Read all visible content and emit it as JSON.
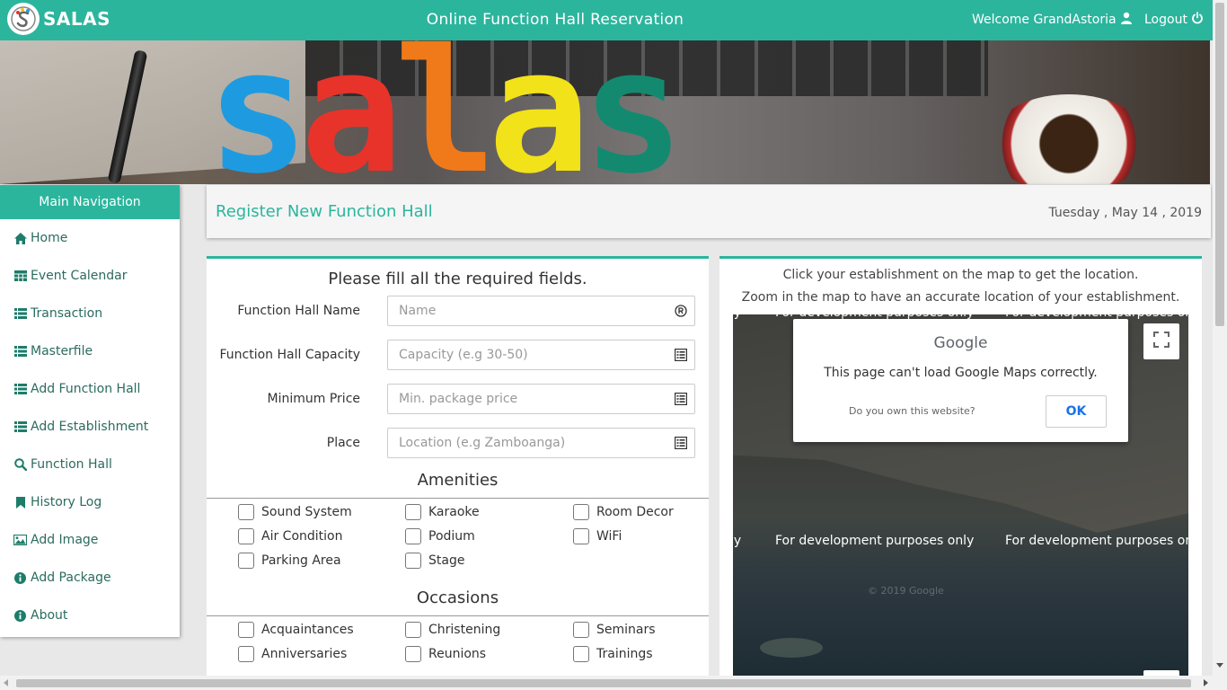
{
  "app": {
    "logo_text": "SALAS",
    "title": "Online Function Hall Reservation",
    "welcome": "Welcome GrandAstoria",
    "logout": "Logout",
    "accent_color": "#2bb59d"
  },
  "banner": {
    "letters": [
      {
        "char": "s",
        "color": "#1e9be0"
      },
      {
        "char": "a",
        "color": "#e8332a"
      },
      {
        "char": "l",
        "color": "#f07a1a"
      },
      {
        "char": "a",
        "color": "#f2e21a"
      },
      {
        "char": "s",
        "color": "#138a6f"
      }
    ]
  },
  "sidebar": {
    "heading": "Main Navigation",
    "items": [
      {
        "label": "Home",
        "icon": "home-icon"
      },
      {
        "label": "Event Calendar",
        "icon": "table-icon"
      },
      {
        "label": "Transaction",
        "icon": "list-icon"
      },
      {
        "label": "Masterfile",
        "icon": "list-icon"
      },
      {
        "label": "Add Function Hall",
        "icon": "list-icon"
      },
      {
        "label": "Add Establishment",
        "icon": "list-icon"
      },
      {
        "label": "Function Hall",
        "icon": "search-icon"
      },
      {
        "label": "History Log",
        "icon": "bookmark-icon"
      },
      {
        "label": "Add Image",
        "icon": "image-icon"
      },
      {
        "label": "Add Package",
        "icon": "info-icon"
      },
      {
        "label": "About",
        "icon": "info-icon"
      }
    ]
  },
  "header": {
    "title": "Register New Function Hall",
    "date": "Tuesday , May 14 , 2019"
  },
  "form": {
    "heading": "Please fill all the required fields.",
    "fields": [
      {
        "label": "Function Hall Name",
        "placeholder": "Name",
        "value": "",
        "icon": "registered-icon"
      },
      {
        "label": "Function Hall Capacity",
        "placeholder": "Capacity (e.g 30-50)",
        "value": "",
        "icon": "list-box-icon"
      },
      {
        "label": "Minimum Price",
        "placeholder": "Min. package price",
        "value": "",
        "icon": "list-box-icon"
      },
      {
        "label": "Place",
        "placeholder": "Location (e.g Zamboanga)",
        "value": "",
        "icon": "list-box-icon"
      }
    ],
    "amenities_title": "Amenities",
    "amenities": [
      [
        "Sound System",
        "Karaoke",
        "Room Decor"
      ],
      [
        "Air Condition",
        "Podium",
        "WiFi"
      ],
      [
        "Parking Area",
        "Stage",
        ""
      ]
    ],
    "occasions_title": "Occasions",
    "occasions": [
      [
        "Acquaintances",
        "Christening",
        "Seminars"
      ],
      [
        "Anniversaries",
        "Reunions",
        "Trainings"
      ]
    ]
  },
  "map": {
    "instruction_1": "Click your establishment on the map to get the location.",
    "instruction_2": "Zoom in the map to have an accurate location of your establishment.",
    "dev_text": "For development purposes only",
    "dev_text_cut_left": "ly",
    "dev_text_cut_right": "For development purposes or",
    "dialog": {
      "logo": "Google",
      "message": "This page can't load Google Maps correctly.",
      "own_site": "Do you own this website?",
      "ok": "OK"
    },
    "copyright": "© 2019 Google"
  }
}
